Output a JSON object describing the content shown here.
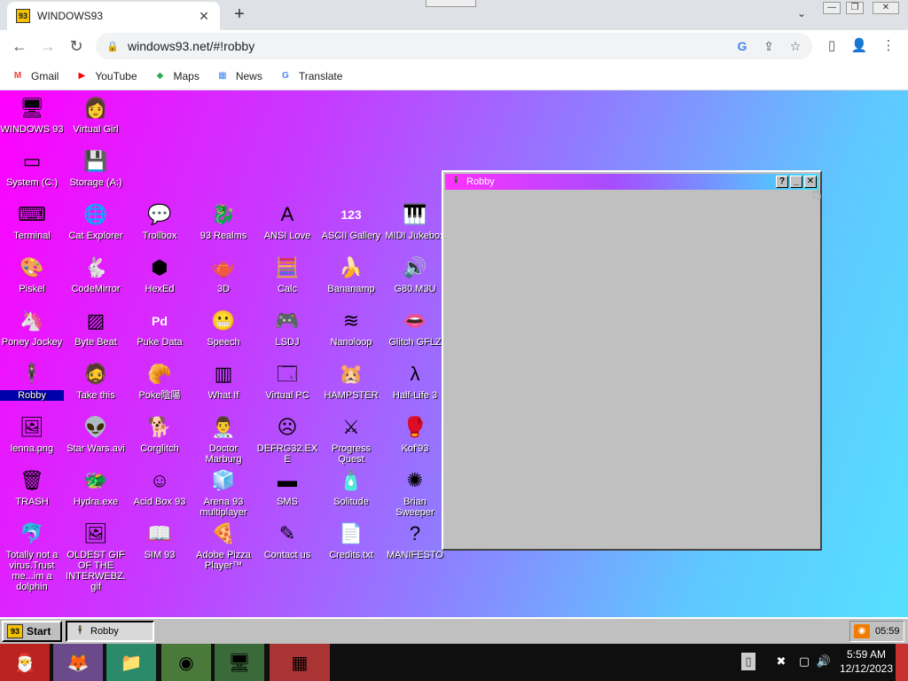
{
  "browser": {
    "tab_title": "WINDOWS93",
    "tab_favicon": "93",
    "url": "windows93.net/#!robby",
    "bookmarks": [
      {
        "label": "Gmail",
        "icon": "M",
        "color": "#ea4335"
      },
      {
        "label": "YouTube",
        "icon": "▶",
        "color": "#ff0000"
      },
      {
        "label": "Maps",
        "icon": "◆",
        "color": "#34a853"
      },
      {
        "label": "News",
        "icon": "▦",
        "color": "#4285f4"
      },
      {
        "label": "Translate",
        "icon": "G",
        "color": "#4285f4"
      }
    ]
  },
  "desktop": {
    "icons": [
      {
        "label": "WINDOWS 93",
        "glyph": "🖥",
        "name": "windows-93"
      },
      {
        "label": "Virtual Girl",
        "glyph": "👩",
        "name": "virtual-girl"
      },
      {
        "label": "System (C:)",
        "glyph": "▭",
        "name": "system-c"
      },
      {
        "label": "Storage (A:)",
        "glyph": "💾",
        "name": "storage-a"
      },
      {
        "label": "Terminal",
        "glyph": "⌨",
        "name": "terminal"
      },
      {
        "label": "Cat Explorer",
        "glyph": "🌐",
        "name": "cat-explorer"
      },
      {
        "label": "Trollbox",
        "glyph": "💬",
        "name": "trollbox"
      },
      {
        "label": "93 Realms",
        "glyph": "🐉",
        "name": "93-realms"
      },
      {
        "label": "ANSI Love",
        "glyph": "A",
        "name": "ansi-love"
      },
      {
        "label": "ASCII Gallery",
        "glyph": "123",
        "name": "ascii-gallery"
      },
      {
        "label": "MIDI Jukebox",
        "glyph": "🎹",
        "name": "midi-jukebox"
      },
      {
        "label": "Piskel",
        "glyph": "🎨",
        "name": "piskel"
      },
      {
        "label": "CodeMirror",
        "glyph": "🐇",
        "name": "codemirror"
      },
      {
        "label": "HexEd",
        "glyph": "⬢",
        "name": "hexed"
      },
      {
        "label": "3D",
        "glyph": "🫖",
        "name": "3d"
      },
      {
        "label": "Calc",
        "glyph": "🧮",
        "name": "calc"
      },
      {
        "label": "Bananamp",
        "glyph": "🍌",
        "name": "bananamp"
      },
      {
        "label": "G80.M3U",
        "glyph": "🔊",
        "name": "g80-m3u"
      },
      {
        "label": "Poney Jockey",
        "glyph": "🦄",
        "name": "poney-jockey"
      },
      {
        "label": "Byte Beat",
        "glyph": "▨",
        "name": "byte-beat"
      },
      {
        "label": "Puke Data",
        "glyph": "Pd",
        "name": "puke-data"
      },
      {
        "label": "Speech",
        "glyph": "😬",
        "name": "speech"
      },
      {
        "label": "LSDJ",
        "glyph": "🎮",
        "name": "lsdj"
      },
      {
        "label": "Nanoloop",
        "glyph": "≋",
        "name": "nanoloop"
      },
      {
        "label": "Glitch GFLZ",
        "glyph": "👄",
        "name": "glitch-gflz"
      },
      {
        "label": "Robby",
        "glyph": "🕴",
        "name": "robby"
      },
      {
        "label": "Take this",
        "glyph": "🧔",
        "name": "take-this"
      },
      {
        "label": "Poke陰陽",
        "glyph": "🥐",
        "name": "poke"
      },
      {
        "label": "What If",
        "glyph": "▥",
        "name": "what-if"
      },
      {
        "label": "Virtual PC",
        "glyph": "🗔",
        "name": "virtual-pc"
      },
      {
        "label": "HAMPSTER",
        "glyph": "🐹",
        "name": "hampster"
      },
      {
        "label": "Half-Life 3",
        "glyph": "λ",
        "name": "half-life-3"
      },
      {
        "label": "lenna.png",
        "glyph": "🖼",
        "name": "lenna-png"
      },
      {
        "label": "Star Wars.avi",
        "glyph": "👽",
        "name": "star-wars-avi"
      },
      {
        "label": "Corglitch",
        "glyph": "🐕",
        "name": "corglitch"
      },
      {
        "label": "Doctor Marburg",
        "glyph": "👨‍⚕️",
        "name": "doctor-marburg"
      },
      {
        "label": "DEFRG32.EXE",
        "glyph": "☹",
        "name": "defrg32-exe"
      },
      {
        "label": "Progress Quest",
        "glyph": "⚔",
        "name": "progress-quest"
      },
      {
        "label": "Kof'93",
        "glyph": "🥊",
        "name": "kof93"
      },
      {
        "label": "TRASH",
        "glyph": "🗑",
        "name": "trash"
      },
      {
        "label": "Hydra.exe",
        "glyph": "🐲",
        "name": "hydra-exe"
      },
      {
        "label": "Acid Box 93",
        "glyph": "☺",
        "name": "acid-box-93"
      },
      {
        "label": "Arena 93 multiplayer",
        "glyph": "🧊",
        "name": "arena-93"
      },
      {
        "label": "SMS",
        "glyph": "▬",
        "name": "sms"
      },
      {
        "label": "Solitude",
        "glyph": "🧴",
        "name": "solitude"
      },
      {
        "label": "Brian Sweeper",
        "glyph": "✺",
        "name": "brian-sweeper"
      },
      {
        "label": "Totally not a virus.Trust me...im a dolphin",
        "glyph": "🐬",
        "name": "dolphin"
      },
      {
        "label": "OLDEST GIF OF THE INTERWEBZ.gif",
        "glyph": "🖼",
        "name": "oldest-gif"
      },
      {
        "label": "SIM 93",
        "glyph": "📖",
        "name": "sim-93"
      },
      {
        "label": "Adobe Pizza Player™",
        "glyph": "🍕",
        "name": "adobe-pizza-player"
      },
      {
        "label": "Contact us",
        "glyph": "✎",
        "name": "contact-us"
      },
      {
        "label": "Credits.txt",
        "glyph": "📄",
        "name": "credits-txt"
      },
      {
        "label": "MANIFESTO",
        "glyph": "?",
        "name": "manifesto"
      }
    ]
  },
  "window": {
    "title": "Robby",
    "help_label": "?",
    "minimize_label": "_",
    "close_label": "✕"
  },
  "taskbar93": {
    "start_label": "Start",
    "task_label": "Robby",
    "tray_time": "05:59"
  },
  "ostaskbar": {
    "time": "5:59 AM",
    "date": "12/12/2023"
  }
}
